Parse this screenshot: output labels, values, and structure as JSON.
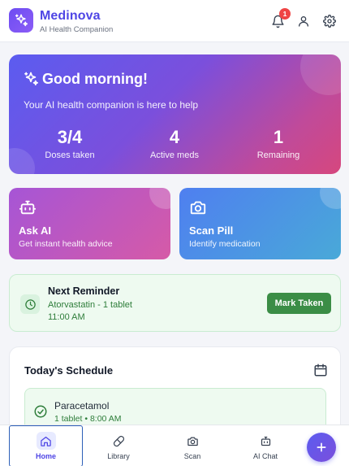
{
  "header": {
    "brand_name": "Medinova",
    "brand_subtitle": "AI Health Companion",
    "notification_count": "1",
    "icons": [
      "sparkles-icon",
      "bell-icon",
      "user-icon",
      "gear-icon"
    ]
  },
  "hero": {
    "title": "Good morning!",
    "subtitle": "Your AI health companion is here to help",
    "stats": [
      {
        "value": "3/4",
        "label": "Doses taken"
      },
      {
        "value": "4",
        "label": "Active meds"
      },
      {
        "value": "1",
        "label": "Remaining"
      }
    ]
  },
  "actions": [
    {
      "title": "Ask AI",
      "subtitle": "Get instant health advice",
      "icon": "robot-icon"
    },
    {
      "title": "Scan Pill",
      "subtitle": "Identify medication",
      "icon": "camera-icon"
    }
  ],
  "reminder": {
    "title": "Next Reminder",
    "drug": "Atorvastatin - 1 tablet",
    "time": "11:00 AM",
    "button_label": "Mark Taken"
  },
  "schedule": {
    "title": "Today's Schedule",
    "items": [
      {
        "name": "Paracetamol",
        "detail": "1 tablet • 8:00 AM",
        "status": "taken"
      }
    ]
  },
  "bottom_nav": {
    "items": [
      {
        "label": "Home",
        "icon": "home-icon",
        "active": true
      },
      {
        "label": "Library",
        "icon": "pill-icon",
        "active": false
      },
      {
        "label": "Scan",
        "icon": "camera-icon",
        "active": false
      },
      {
        "label": "AI Chat",
        "icon": "robot-icon",
        "active": false
      }
    ],
    "fab_icon": "plus-icon"
  },
  "colors": {
    "brand": "#4f46e5",
    "hero_gradient_start": "#5b5cf0",
    "hero_gradient_end": "#d6477e",
    "success": "#3b8d46",
    "badge": "#ef4444"
  }
}
